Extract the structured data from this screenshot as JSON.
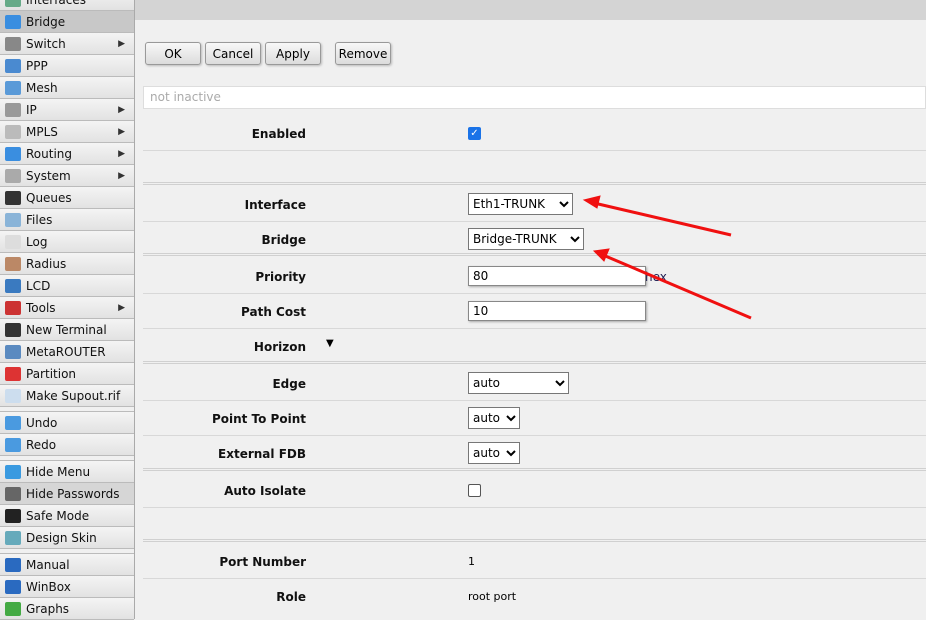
{
  "sidebar": {
    "items": [
      {
        "label": "Interfaces",
        "icon": "interfaces-icon",
        "color": "#6a8"
      },
      {
        "label": "Bridge",
        "icon": "bridge-icon",
        "color": "#3a8ee0",
        "selected": true
      },
      {
        "label": "Switch",
        "icon": "switch-icon",
        "color": "#888",
        "sub": true
      },
      {
        "label": "PPP",
        "icon": "ppp-icon",
        "color": "#4a8ad0"
      },
      {
        "label": "Mesh",
        "icon": "mesh-icon",
        "color": "#5a9ad8"
      },
      {
        "label": "IP",
        "icon": "ip-icon",
        "color": "#999",
        "sub": true
      },
      {
        "label": "MPLS",
        "icon": "mpls-icon",
        "color": "#bbb",
        "sub": true
      },
      {
        "label": "Routing",
        "icon": "routing-icon",
        "color": "#3a8ee0",
        "sub": true
      },
      {
        "label": "System",
        "icon": "gear-icon",
        "color": "#aaa",
        "sub": true
      },
      {
        "label": "Queues",
        "icon": "queues-icon",
        "color": "#333"
      },
      {
        "label": "Files",
        "icon": "folder-icon",
        "color": "#8ab4d8"
      },
      {
        "label": "Log",
        "icon": "log-icon",
        "color": "#ddd"
      },
      {
        "label": "Radius",
        "icon": "radius-icon",
        "color": "#b86"
      },
      {
        "label": "LCD",
        "icon": "lcd-icon",
        "color": "#3a7ac0"
      },
      {
        "label": "Tools",
        "icon": "tools-icon",
        "color": "#c33",
        "sub": true
      },
      {
        "label": "New Terminal",
        "icon": "terminal-icon",
        "color": "#333"
      },
      {
        "label": "MetaROUTER",
        "icon": "metarouter-icon",
        "color": "#5a8ac0"
      },
      {
        "label": "Partition",
        "icon": "partition-icon",
        "color": "#d33"
      },
      {
        "label": "Make Supout.rif",
        "icon": "document-icon",
        "color": "#cde"
      },
      {
        "gap": true
      },
      {
        "label": "Undo",
        "icon": "undo-icon",
        "color": "#4a9ae0"
      },
      {
        "label": "Redo",
        "icon": "redo-icon",
        "color": "#4a9ae0"
      },
      {
        "gap": true
      },
      {
        "label": "Hide Menu",
        "icon": "hide-menu-icon",
        "color": "#3a9ae0"
      },
      {
        "label": "Hide Passwords",
        "icon": "password-icon",
        "color": "#666",
        "highlight": true
      },
      {
        "label": "Safe Mode",
        "icon": "umbrella-icon",
        "color": "#222"
      },
      {
        "label": "Design Skin",
        "icon": "design-skin-icon",
        "color": "#6ab"
      },
      {
        "gap": true
      },
      {
        "label": "Manual",
        "icon": "help-icon",
        "color": "#2a6ac0"
      },
      {
        "label": "WinBox",
        "icon": "winbox-icon",
        "color": "#2a6ac0"
      },
      {
        "label": "Graphs",
        "icon": "graphs-icon",
        "color": "#4a4"
      }
    ]
  },
  "toolbar": {
    "ok": "OK",
    "cancel": "Cancel",
    "apply": "Apply",
    "remove": "Remove"
  },
  "status": "not inactive",
  "form": {
    "enabled": {
      "label": "Enabled",
      "checked": true
    },
    "interface": {
      "label": "Interface",
      "value": "Eth1-TRUNK"
    },
    "bridge": {
      "label": "Bridge",
      "value": "Bridge-TRUNK"
    },
    "priority": {
      "label": "Priority",
      "value": "80",
      "unit": "hex"
    },
    "path_cost": {
      "label": "Path Cost",
      "value": "10"
    },
    "horizon": {
      "label": "Horizon"
    },
    "edge": {
      "label": "Edge",
      "value": "auto"
    },
    "point_to_point": {
      "label": "Point To Point",
      "value": "auto"
    },
    "external_fdb": {
      "label": "External FDB",
      "value": "auto"
    },
    "auto_isolate": {
      "label": "Auto Isolate",
      "checked": false
    },
    "port_number": {
      "label": "Port Number",
      "value": "1"
    },
    "role": {
      "label": "Role",
      "value": "root port"
    }
  },
  "annotation_color": "#f01010"
}
